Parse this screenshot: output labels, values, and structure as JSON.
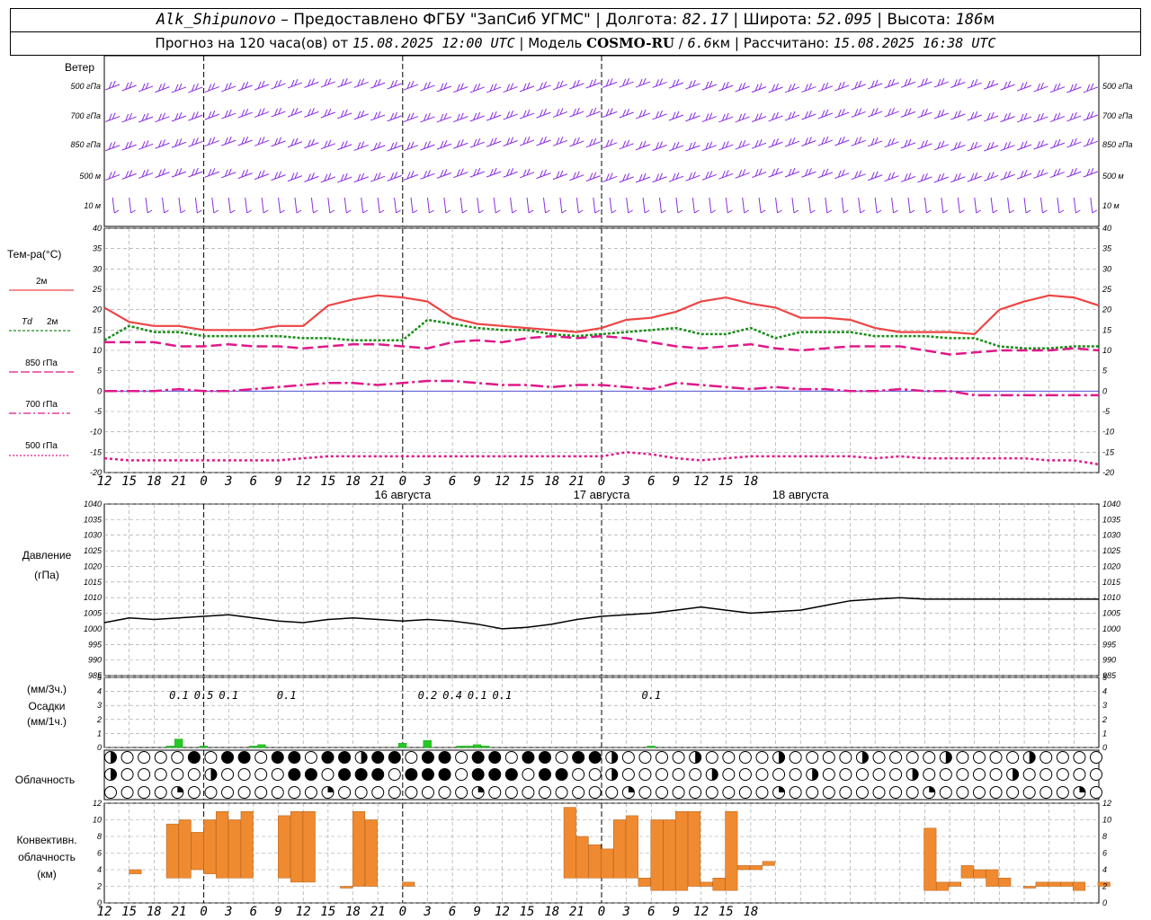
{
  "header": {
    "station": "Alk_Shipunovo",
    "provider": "Предоставлено ФГБУ \"ЗапСиб УГМС\"",
    "lon_label": "Долгота:",
    "lon_value": "82.17",
    "lat_label": "Широта:",
    "lat_value": "52.095",
    "alt_label": "Высота:",
    "alt_value": "186",
    "alt_unit": "м",
    "forecast_label": "Прогноз на 120 часа(ов) от",
    "forecast_start": "15.08.2025 12:00 UTC",
    "model_label": "Модель",
    "model_name": "COSMO-RU",
    "model_res": "6.6",
    "model_unit": "км",
    "calc_label": "Рассчитано:",
    "calc_time": "15.08.2025 16:38 UTC"
  },
  "colors": {
    "t2m": "#ee4444",
    "td2m": "#1a8c1a",
    "t850": "#e0188a",
    "t700": "#e0188a",
    "t500": "#e0188a",
    "wind": "#8a2be2",
    "pressure": "#000000",
    "precip": "#22cc22",
    "convective": "#f08a30",
    "grid": "#999999"
  },
  "chart_data": [
    {
      "type": "wind_barbs",
      "title": "Ветер",
      "levels": [
        "500 гПа",
        "700 гПа",
        "850 гПа",
        "500 м",
        "10 м"
      ]
    },
    {
      "type": "line",
      "ylabel": "Тем-ра(°C)",
      "ylim": [
        -20,
        40
      ],
      "yticks": [
        -20,
        -15,
        -10,
        -5,
        0,
        5,
        10,
        15,
        20,
        25,
        30,
        35,
        40
      ],
      "x_hours": [
        0,
        3,
        6,
        9,
        12,
        15,
        18,
        21,
        24,
        27,
        30,
        33,
        36,
        39,
        42,
        45,
        48,
        51,
        54,
        57,
        60,
        63,
        66,
        69,
        72,
        75,
        78,
        81,
        84,
        87,
        90,
        93,
        96,
        99,
        102,
        105,
        108,
        111,
        114,
        117,
        120
      ],
      "x_tick_labels": [
        "12",
        "15",
        "18",
        "21",
        "0",
        "3",
        "6",
        "9",
        "12",
        "15",
        "18",
        "21",
        "0",
        "3",
        "6",
        "9",
        "12",
        "15",
        "18",
        "21",
        "0",
        "3",
        "6",
        "9",
        "12",
        "15",
        "18",
        "21",
        "0",
        "3",
        "6",
        "9",
        "12",
        "15",
        "18",
        "21",
        "0",
        "3",
        "6",
        "9",
        "12"
      ],
      "visible_tick_labels": [
        "12",
        "15",
        "18",
        "21",
        "0",
        "3",
        "6",
        "9",
        "12",
        "15",
        "18",
        "21",
        "0",
        "3",
        "6",
        "9",
        "12",
        "15",
        "18",
        "21",
        "0",
        "3",
        "6",
        "9",
        "12",
        "15",
        "18"
      ],
      "date_labels": [
        "16 августа",
        "17 августа",
        "18 августа"
      ],
      "series": [
        {
          "name": "2м",
          "values": [
            20.5,
            17,
            16,
            16,
            15,
            15,
            15,
            16,
            16,
            21,
            22.5,
            23.5,
            23,
            22,
            18,
            16.5,
            16,
            15.5,
            15,
            14.5,
            15.5,
            17.5,
            18,
            19.5,
            22,
            23,
            21.5,
            20.5,
            18,
            18,
            17.5,
            15.5,
            14.5,
            14.5,
            14.5,
            14,
            20,
            22,
            23.5,
            23,
            21
          ]
        },
        {
          "name": "Td 2м",
          "values": [
            12.5,
            16,
            14.5,
            14.5,
            13.5,
            13.5,
            13.5,
            13.5,
            13,
            13,
            12.5,
            12.5,
            12.5,
            17.5,
            16.5,
            15.5,
            15,
            15,
            14,
            13.5,
            14,
            14.5,
            15,
            15.5,
            14,
            14,
            15.5,
            13,
            14.5,
            14.5,
            14.5,
            13.5,
            13.5,
            13.5,
            13,
            13,
            11,
            10.5,
            10.5,
            11,
            11
          ]
        },
        {
          "name": "850 гПа",
          "values": [
            12,
            12,
            12,
            11,
            11,
            11.5,
            11,
            11,
            10.5,
            11,
            11.5,
            11.5,
            11,
            10.5,
            12,
            12.5,
            12,
            13,
            13.5,
            13,
            13.5,
            13,
            12,
            11,
            10.5,
            11,
            11.5,
            10.5,
            10,
            10.5,
            11,
            11,
            11,
            10,
            9,
            9.5,
            10,
            10,
            10,
            10.5,
            10
          ]
        },
        {
          "name": "700 гПа",
          "values": [
            0,
            0,
            0,
            0.5,
            0,
            0,
            0.5,
            1,
            1.5,
            2,
            2,
            1.5,
            2,
            2.5,
            2.5,
            2,
            1.5,
            1.5,
            1,
            1.5,
            1.5,
            1,
            0.5,
            2,
            1.5,
            1,
            0.5,
            1,
            0.5,
            0.5,
            0,
            0,
            0.5,
            0,
            0,
            -1,
            -1,
            -1,
            -1,
            -1,
            -1
          ]
        },
        {
          "name": "500 гПа",
          "values": [
            -16.5,
            -17,
            -17,
            -17,
            -17,
            -17,
            -17,
            -17,
            -16.5,
            -16,
            -16,
            -16,
            -16,
            -16,
            -16,
            -16,
            -16,
            -16,
            -16,
            -16,
            -16,
            -15,
            -15.5,
            -16.5,
            -17,
            -16.5,
            -16,
            -16,
            -16,
            -16,
            -16,
            -16.5,
            -16,
            -16.5,
            -16.5,
            -16.5,
            -16.5,
            -16.5,
            -17,
            -17,
            -18
          ]
        }
      ]
    },
    {
      "type": "line",
      "ylabel": "Давление",
      "yunit": "(гПа)",
      "ylim": [
        985,
        1040
      ],
      "yticks": [
        985,
        990,
        995,
        1000,
        1005,
        1010,
        1015,
        1020,
        1025,
        1030,
        1035,
        1040
      ],
      "series": [
        {
          "name": "",
          "values": [
            1002,
            1003.5,
            1003,
            1003.5,
            1004,
            1004.5,
            1003.5,
            1002.5,
            1002,
            1003,
            1003.5,
            1003,
            1002.5,
            1003,
            1002.5,
            1001.5,
            1000,
            1000.5,
            1001.5,
            1003,
            1004,
            1004.5,
            1005,
            1006,
            1007,
            1006,
            1005,
            1005.5,
            1006,
            1007.5,
            1009,
            1009.5,
            1010,
            1009.5,
            1009.5,
            1009.5,
            1009.5,
            1009.5,
            1009.5,
            1009.5,
            1009.5
          ]
        }
      ]
    },
    {
      "type": "bar",
      "ylabel": "(мм/3ч.)",
      "title": "Осадки",
      "yunit": "(мм/1ч.)",
      "ylim": [
        0,
        5
      ],
      "yticks": [
        0,
        1,
        2,
        3,
        4,
        5
      ],
      "labels": [
        {
          "hour": 9,
          "text": "0.1"
        },
        {
          "hour": 12,
          "text": "0.5"
        },
        {
          "hour": 15,
          "text": "0.1"
        },
        {
          "hour": 22,
          "text": "0.1"
        },
        {
          "hour": 39,
          "text": "0.2"
        },
        {
          "hour": 42,
          "text": "0.4"
        },
        {
          "hour": 45,
          "text": "0.1"
        },
        {
          "hour": 48,
          "text": "0.1"
        },
        {
          "hour": 66,
          "text": "0.1"
        }
      ],
      "hourly_bars": [
        {
          "hour": 8,
          "value": 0.1
        },
        {
          "hour": 9,
          "value": 0.6
        },
        {
          "hour": 12,
          "value": 0.1
        },
        {
          "hour": 18,
          "value": 0.1
        },
        {
          "hour": 19,
          "value": 0.2
        },
        {
          "hour": 36,
          "value": 0.3
        },
        {
          "hour": 39,
          "value": 0.5
        },
        {
          "hour": 43,
          "value": 0.1
        },
        {
          "hour": 44,
          "value": 0.1
        },
        {
          "hour": 45,
          "value": 0.2
        },
        {
          "hour": 46,
          "value": 0.1
        },
        {
          "hour": 66,
          "value": 0.1
        }
      ]
    },
    {
      "type": "cloud_symbols",
      "title": "Облачность",
      "rows": [
        "upper",
        "middle",
        "low"
      ]
    },
    {
      "type": "bar",
      "ylabel": "Конвективн. облачность (км)",
      "ylim": [
        0,
        12
      ],
      "yticks": [
        0,
        2,
        4,
        6,
        8,
        10,
        12
      ],
      "ranges": [
        {
          "hour": 2,
          "base": 3.5,
          "top": 4
        },
        {
          "hour": 5,
          "base": 3,
          "top": 9.5
        },
        {
          "hour": 6,
          "base": 3,
          "top": 10
        },
        {
          "hour": 7,
          "base": 4,
          "top": 8.5
        },
        {
          "hour": 8,
          "base": 3.5,
          "top": 10
        },
        {
          "hour": 9,
          "base": 3,
          "top": 11
        },
        {
          "hour": 10,
          "base": 3,
          "top": 10
        },
        {
          "hour": 11,
          "base": 3,
          "top": 11
        },
        {
          "hour": 14,
          "base": 3,
          "top": 10.5
        },
        {
          "hour": 15,
          "base": 2.5,
          "top": 11
        },
        {
          "hour": 16,
          "base": 2.5,
          "top": 11
        },
        {
          "hour": 19,
          "base": 2,
          "top": 2
        },
        {
          "hour": 20,
          "base": 2,
          "top": 11
        },
        {
          "hour": 21,
          "base": 2,
          "top": 10
        },
        {
          "hour": 24,
          "base": 2,
          "top": 2.5
        },
        {
          "hour": 37,
          "base": 3,
          "top": 11.5
        },
        {
          "hour": 38,
          "base": 3,
          "top": 8
        },
        {
          "hour": 39,
          "base": 3,
          "top": 7
        },
        {
          "hour": 40,
          "base": 3,
          "top": 6.5
        },
        {
          "hour": 41,
          "base": 3,
          "top": 10
        },
        {
          "hour": 42,
          "base": 3,
          "top": 10.5
        },
        {
          "hour": 43,
          "base": 2,
          "top": 3
        },
        {
          "hour": 44,
          "base": 1.5,
          "top": 10
        },
        {
          "hour": 45,
          "base": 1.5,
          "top": 10
        },
        {
          "hour": 46,
          "base": 1.5,
          "top": 11
        },
        {
          "hour": 47,
          "base": 2,
          "top": 11
        },
        {
          "hour": 48,
          "base": 2,
          "top": 2.5
        },
        {
          "hour": 49,
          "base": 1.5,
          "top": 3
        },
        {
          "hour": 50,
          "base": 1.5,
          "top": 11
        },
        {
          "hour": 51,
          "base": 4,
          "top": 4.5
        },
        {
          "hour": 52,
          "base": 4,
          "top": 4.5
        },
        {
          "hour": 53,
          "base": 4.5,
          "top": 5
        },
        {
          "hour": 66,
          "base": 1.5,
          "top": 9
        },
        {
          "hour": 67,
          "base": 1.5,
          "top": 2.5
        },
        {
          "hour": 68,
          "base": 2,
          "top": 2.5
        },
        {
          "hour": 69,
          "base": 3,
          "top": 4.5
        },
        {
          "hour": 70,
          "base": 3,
          "top": 4
        },
        {
          "hour": 71,
          "base": 2,
          "top": 4
        },
        {
          "hour": 72,
          "base": 2,
          "top": 3
        },
        {
          "hour": 74,
          "base": 2,
          "top": 2
        },
        {
          "hour": 75,
          "base": 2,
          "top": 2.5
        },
        {
          "hour": 76,
          "base": 2,
          "top": 2.5
        },
        {
          "hour": 77,
          "base": 2,
          "top": 2.5
        },
        {
          "hour": 78,
          "base": 1.5,
          "top": 2.5
        },
        {
          "hour": 80,
          "base": 2,
          "top": 2.5
        }
      ]
    }
  ],
  "legend": {
    "wind_title": "Ветер",
    "temp_title": "Тем-ра(°C)",
    "t2m": "2м",
    "td_prefix": "Td",
    "td_suffix": "2м",
    "t850": "850 гПа",
    "t700": "700 гПа",
    "t500": "500 гПа",
    "press_title": "Давление",
    "press_unit": "(гПа)",
    "precip_unit3": "(мм/3ч.)",
    "precip_title": "Осадки",
    "precip_unit1": "(мм/1ч.)",
    "cloud_title": "Облачность",
    "conv_line1": "Конвективн.",
    "conv_line2": "облачность",
    "conv_line3": "(км)"
  }
}
